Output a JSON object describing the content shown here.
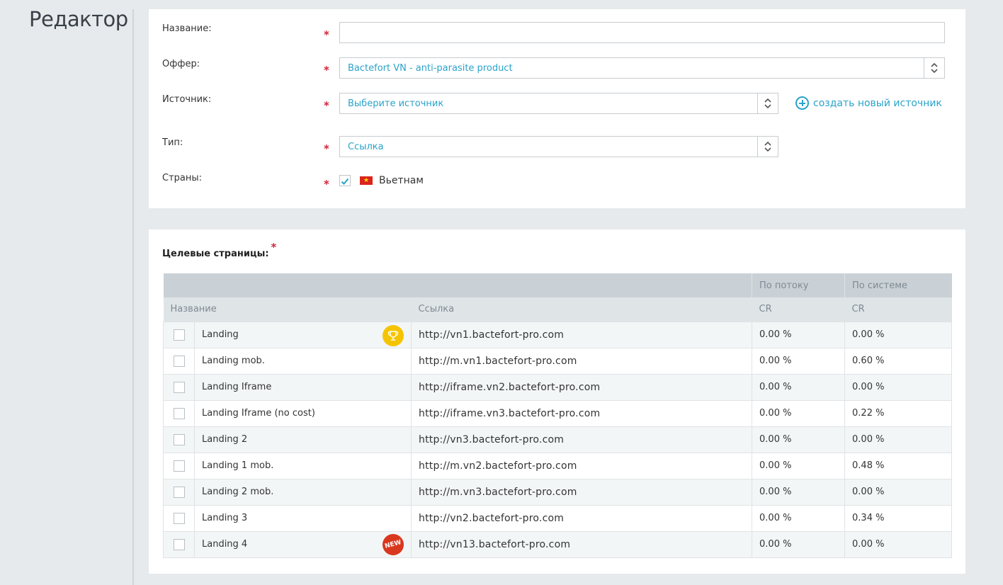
{
  "page": {
    "title": "Редактор"
  },
  "form": {
    "name": {
      "label": "Название:",
      "value": ""
    },
    "offer": {
      "label": "Оффер:",
      "value": "Bactefort VN - anti-parasite product"
    },
    "source": {
      "label": "Источник:",
      "value": "Выберите источник",
      "create_link": "создать новый источник"
    },
    "type": {
      "label": "Тип:",
      "value": "Ссылка"
    },
    "countries": {
      "label": "Страны:",
      "items": [
        {
          "name": "Вьетнам",
          "checked": true,
          "flag": "vn-flag-icon"
        }
      ]
    },
    "required_mark": "*"
  },
  "landings": {
    "title": "Целевые страницы:",
    "required_mark": "*",
    "group_headers": {
      "flow": "По потоку",
      "system": "По системе"
    },
    "columns": {
      "name": "Название",
      "link": "Ссылка",
      "cr_flow": "CR",
      "cr_system": "CR"
    },
    "rows": [
      {
        "name": "Landing",
        "link": "http://vn1.bactefort-pro.com",
        "cr_flow": "0.00 %",
        "cr_system": "0.00 %",
        "badge": "trophy-icon"
      },
      {
        "name": "Landing mob.",
        "link": "http://m.vn1.bactefort-pro.com",
        "cr_flow": "0.00 %",
        "cr_system": "0.60 %"
      },
      {
        "name": "Landing Iframe",
        "link": "http://iframe.vn2.bactefort-pro.com",
        "cr_flow": "0.00 %",
        "cr_system": "0.00 %"
      },
      {
        "name": "Landing Iframe (no cost)",
        "link": "http://iframe.vn3.bactefort-pro.com",
        "cr_flow": "0.00 %",
        "cr_system": "0.22 %"
      },
      {
        "name": "Landing 2",
        "link": "http://vn3.bactefort-pro.com",
        "cr_flow": "0.00 %",
        "cr_system": "0.00 %"
      },
      {
        "name": "Landing 1 mob.",
        "link": "http://m.vn2.bactefort-pro.com",
        "cr_flow": "0.00 %",
        "cr_system": "0.48 %"
      },
      {
        "name": "Landing 2 mob.",
        "link": "http://m.vn3.bactefort-pro.com",
        "cr_flow": "0.00 %",
        "cr_system": "0.00 %"
      },
      {
        "name": "Landing 3",
        "link": "http://vn2.bactefort-pro.com",
        "cr_flow": "0.00 %",
        "cr_system": "0.34 %"
      },
      {
        "name": "Landing 4",
        "link": "http://vn13.bactefort-pro.com",
        "cr_flow": "0.00 %",
        "cr_system": "0.00 %",
        "badge": "new-badge-icon",
        "badge_text": "NEW"
      }
    ]
  },
  "colors": {
    "accent": "#2aa3c9",
    "required": "#d0263c",
    "background": "#e6eaec"
  }
}
